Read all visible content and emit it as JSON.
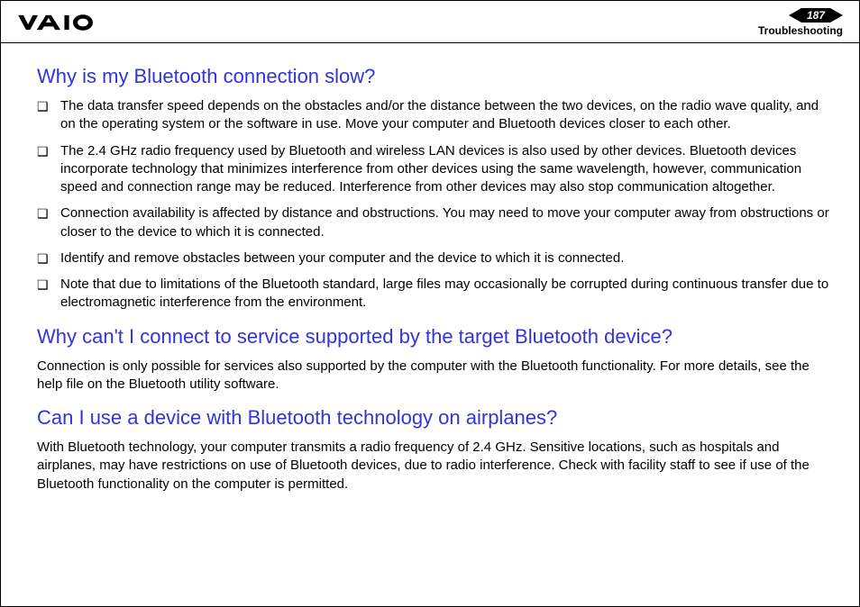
{
  "header": {
    "page_number": "187",
    "section": "Troubleshooting"
  },
  "sections": [
    {
      "heading": "Why is my Bluetooth connection slow?",
      "type": "list",
      "items": [
        "The data transfer speed depends on the obstacles and/or the distance between the two devices, on the radio wave quality, and on the operating system or the software in use. Move your computer and Bluetooth devices closer to each other.",
        "The 2.4 GHz radio frequency used by Bluetooth and wireless LAN devices is also used by other devices. Bluetooth devices incorporate technology that minimizes interference from other devices using the same wavelength, however, communication speed and connection range may be reduced. Interference from other devices may also stop communication altogether.",
        "Connection availability is affected by distance and obstructions. You may need to move your computer away from obstructions or closer to the device to which it is connected.",
        "Identify and remove obstacles between your computer and the device to which it is connected.",
        "Note that due to limitations of the Bluetooth standard, large files may occasionally be corrupted during continuous transfer due to electromagnetic interference from the environment."
      ]
    },
    {
      "heading": "Why can't I connect to service supported by the target Bluetooth device?",
      "type": "paragraph",
      "text": "Connection is only possible for services also supported by the computer with the Bluetooth functionality. For more details, see the help file on the Bluetooth utility software."
    },
    {
      "heading": "Can I use a device with Bluetooth technology on airplanes?",
      "type": "paragraph",
      "text": "With Bluetooth technology, your computer transmits a radio frequency of 2.4 GHz. Sensitive locations, such as hospitals and airplanes, may have restrictions on use of Bluetooth devices, due to radio interference. Check with facility staff to see if use of the Bluetooth functionality on the computer is permitted."
    }
  ]
}
